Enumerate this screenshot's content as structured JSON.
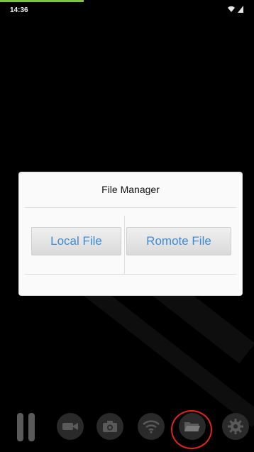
{
  "status_bar": {
    "time": "14:36",
    "progress_fraction": 0.33,
    "icons": [
      "wifi-icon",
      "signal-icon"
    ]
  },
  "dialog": {
    "title": "File Manager",
    "buttons": {
      "local_label": "Local File",
      "remote_label": "Romote File"
    }
  },
  "toolbar": {
    "items": [
      "pause-icon",
      "video-camera-icon",
      "camera-icon",
      "wifi-icon",
      "folder-icon",
      "settings-gear-icon"
    ],
    "highlighted_item": "folder-icon"
  },
  "colors": {
    "background": "#000000",
    "accent_blue": "#3d8bd6",
    "progress_green": "#7ec54a",
    "highlight_red": "#e1251b"
  }
}
